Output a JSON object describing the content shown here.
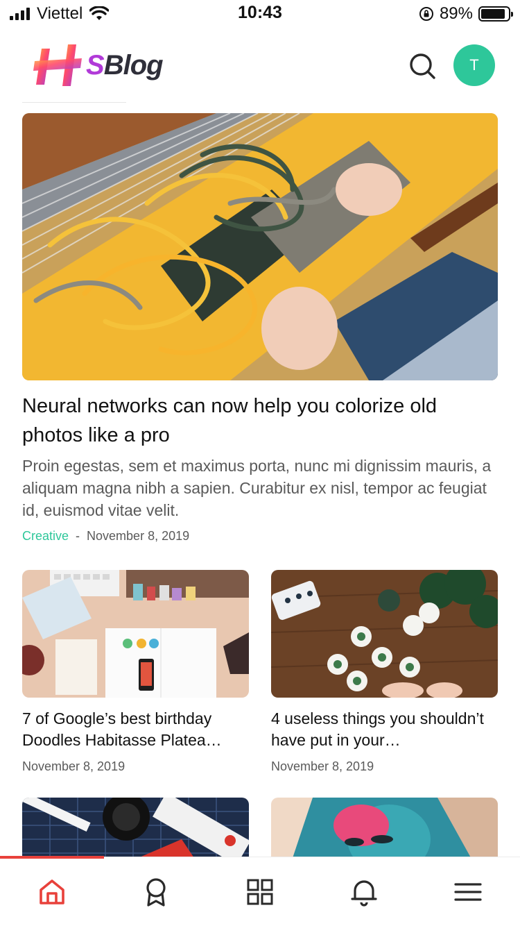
{
  "status_bar": {
    "carrier": "Viettel",
    "time": "10:43",
    "battery": "89%",
    "battery_level": 0.89,
    "signal_bars": 4
  },
  "header": {
    "logo_mark": "H",
    "logo_text_s": "S",
    "logo_text": "Blog",
    "search_icon": "search-icon",
    "avatar_initial": "T",
    "avatar_color": "#2ec79a"
  },
  "featured": {
    "title": "Neural networks can now help you colorize old photos like a pro",
    "excerpt": "Proin egestas, sem et maximus porta, nunc mi dignissim mauris, a aliquam magna nibh a sapien. Curabitur ex nisl, tempor ac feugiat id, euismod vitae velit.",
    "category": "Creative",
    "separator": "-",
    "date": "November 8, 2019"
  },
  "articles": [
    {
      "title": "7 of Google’s best birthday Doodles Habitasse Platea…",
      "date": "November 8, 2019"
    },
    {
      "title": "4 useless things you shouldn’t have put in your…",
      "date": "November 8, 2019"
    }
  ],
  "tabbar": {
    "items": [
      "home-icon",
      "award-icon",
      "grid-icon",
      "bell-icon",
      "menu-icon"
    ],
    "active": "home-icon",
    "active_color": "#e8413b"
  },
  "colors": {
    "accent": "#2ec79a",
    "active_tab": "#e8413b",
    "text": "#1a1a1a",
    "muted": "#5a5a5a"
  }
}
